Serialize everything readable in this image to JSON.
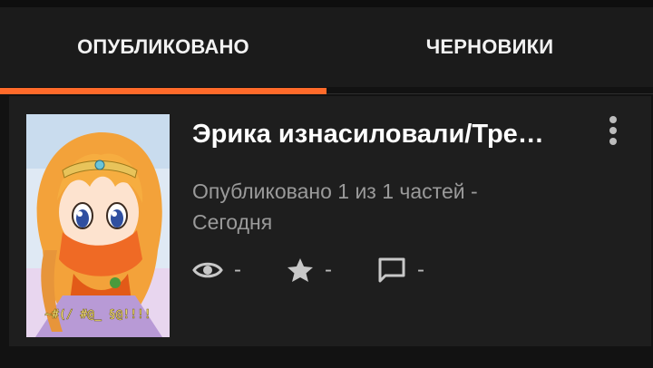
{
  "tabs": [
    {
      "label": "ОПУБЛИКОВАНО",
      "active": true
    },
    {
      "label": "ЧЕРНОВИКИ",
      "active": false
    }
  ],
  "accent_color": "#ff6a2a",
  "story": {
    "title": "Эрика изнасиловали/Тре…",
    "status_line_1": "Опубликовано 1 из 1 частей -",
    "status_line_2": "Сегодня",
    "stats": {
      "views_icon": "eye-icon",
      "views": "-",
      "votes_icon": "star-icon",
      "votes": "-",
      "comments_icon": "comment-icon",
      "comments": "-"
    },
    "menu_icon": "more-vertical-icon",
    "cover_overlay_text": "~#(/ #@_ §@!!!!"
  }
}
